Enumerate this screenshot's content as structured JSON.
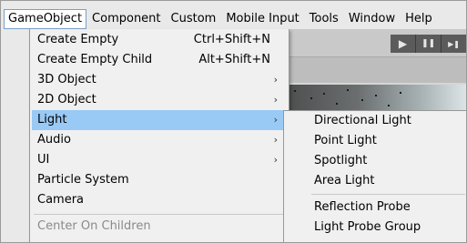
{
  "menubar": {
    "items": [
      {
        "label": "GameObject"
      },
      {
        "label": "Component"
      },
      {
        "label": "Custom"
      },
      {
        "label": "Mobile Input"
      },
      {
        "label": "Tools"
      },
      {
        "label": "Window"
      },
      {
        "label": "Help"
      }
    ]
  },
  "gameobject_menu": {
    "items": [
      {
        "label": "Create Empty",
        "shortcut": "Ctrl+Shift+N"
      },
      {
        "label": "Create Empty Child",
        "shortcut": "Alt+Shift+N"
      },
      {
        "label": "3D Object",
        "has_submenu": true
      },
      {
        "label": "2D Object",
        "has_submenu": true
      },
      {
        "label": "Light",
        "has_submenu": true,
        "highlighted": true
      },
      {
        "label": "Audio",
        "has_submenu": true
      },
      {
        "label": "UI",
        "has_submenu": true
      },
      {
        "label": "Particle System"
      },
      {
        "label": "Camera"
      },
      {
        "label": "Center On Children",
        "disabled": true
      }
    ],
    "submenu_arrow": "›"
  },
  "light_submenu": {
    "items": [
      {
        "label": "Directional Light"
      },
      {
        "label": "Point Light"
      },
      {
        "label": "Spotlight"
      },
      {
        "label": "Area Light"
      },
      {
        "label": "Reflection Probe"
      },
      {
        "label": "Light Probe Group"
      }
    ]
  },
  "toolbar": {
    "play_icon": "▶",
    "pause_icon": "❚❚",
    "step_icon": "▶❚"
  },
  "colors": {
    "highlight": "#99c9f5",
    "menu_bg": "#f0f0f0",
    "disabled_text": "#8a8a8a"
  }
}
